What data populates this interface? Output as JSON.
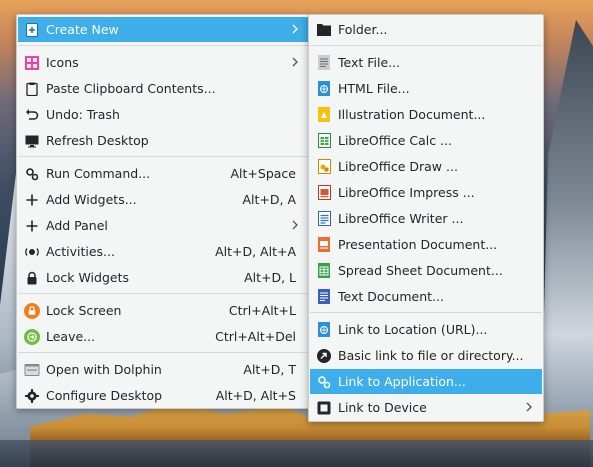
{
  "main_menu": {
    "create_new": "Create New",
    "icons": "Icons",
    "paste_clipboard": "Paste Clipboard Contents...",
    "undo_trash": "Undo: Trash",
    "refresh_desktop": "Refresh Desktop",
    "run_command": {
      "label": "Run Command...",
      "shortcut": "Alt+Space"
    },
    "add_widgets": {
      "label": "Add Widgets...",
      "shortcut": "Alt+D, A"
    },
    "add_panel": "Add Panel",
    "activities": {
      "label": "Activities...",
      "shortcut": "Alt+D, Alt+A"
    },
    "lock_widgets": {
      "label": "Lock Widgets",
      "shortcut": "Alt+D, L"
    },
    "lock_screen": {
      "label": "Lock Screen",
      "shortcut": "Ctrl+Alt+L"
    },
    "leave": {
      "label": "Leave...",
      "shortcut": "Ctrl+Alt+Del"
    },
    "open_dolphin": {
      "label": "Open with Dolphin",
      "shortcut": "Alt+D, T"
    },
    "configure_desktop": {
      "label": "Configure Desktop",
      "shortcut": "Alt+D, Alt+S"
    }
  },
  "sub_menu": {
    "folder": "Folder...",
    "text_file": "Text File...",
    "html_file": "HTML File...",
    "illustration": "Illustration Document...",
    "lo_calc": "LibreOffice Calc  ...",
    "lo_draw": "LibreOffice Draw  ...",
    "lo_impress": "LibreOffice Impress  ...",
    "lo_writer": "LibreOffice Writer  ...",
    "presentation": "Presentation Document...",
    "spreadsheet": "Spread Sheet Document...",
    "text_document": "Text Document...",
    "link_url": "Link to Location (URL)...",
    "basic_link": "Basic link to file or directory...",
    "link_application": "Link to Application...",
    "link_device": "Link to Device"
  },
  "colors": {
    "highlight": "#3daee9",
    "menu_bg": "#f4f5f5",
    "text": "#232629"
  }
}
